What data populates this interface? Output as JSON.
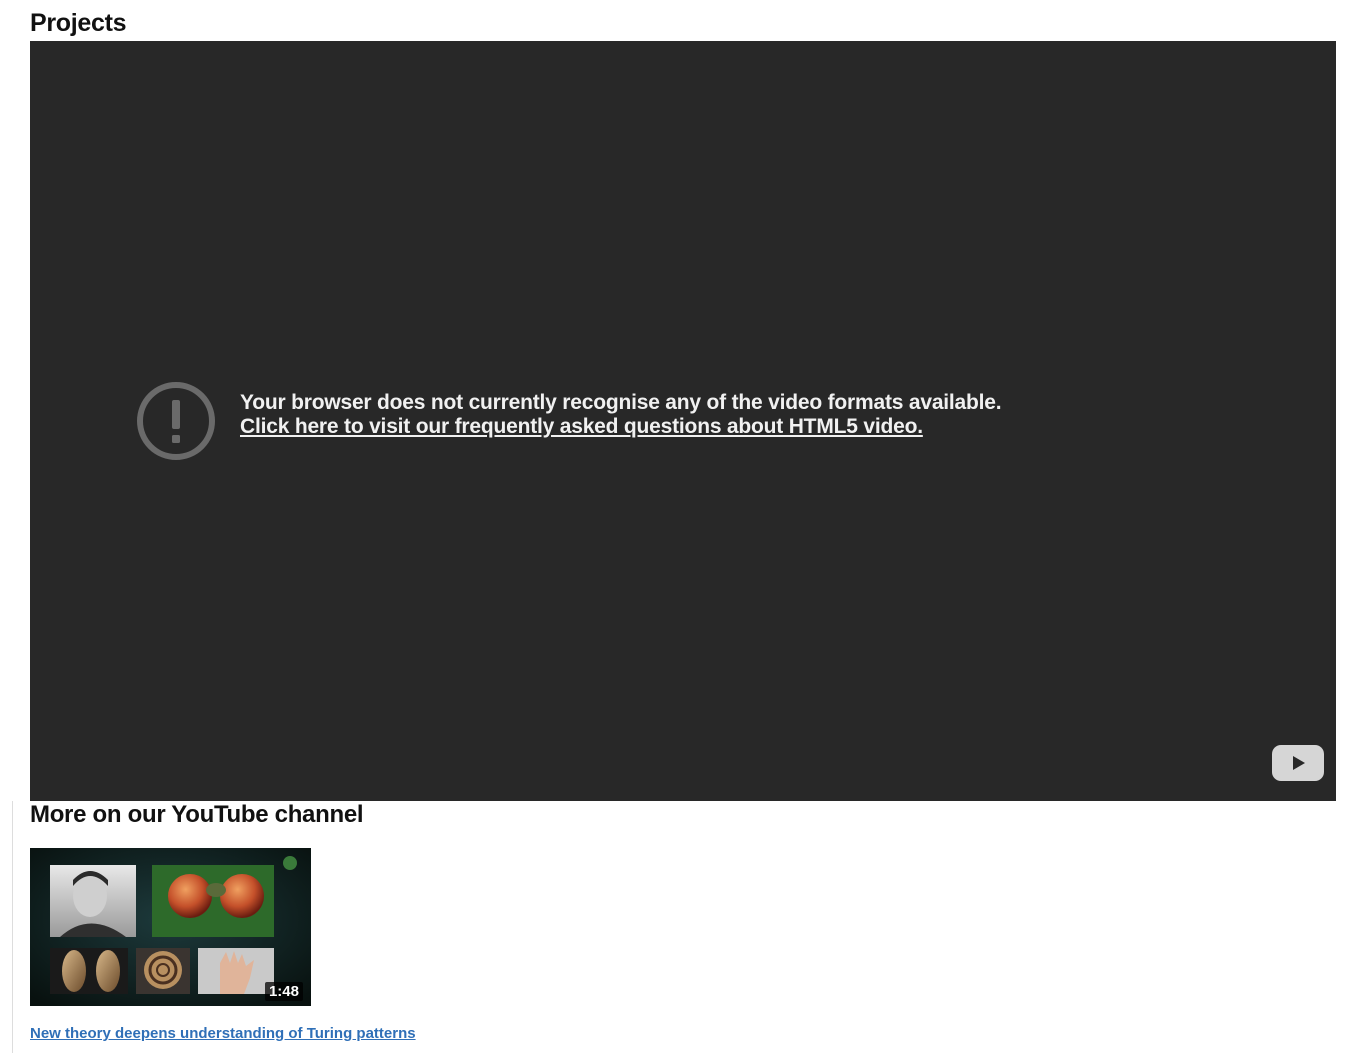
{
  "projects": {
    "title": "Projects"
  },
  "video_player": {
    "error_message": "Your browser does not currently recognise any of the video formats available.",
    "faq_link_label": "Click here to visit our frequently asked questions about HTML5 video.",
    "error_icon": "exclamation-circle-icon",
    "logo_icon": "youtube-play-icon"
  },
  "channel": {
    "title": "More on our YouTube channel",
    "videos": [
      {
        "duration": "1:48",
        "title": "New theory deepens understanding of Turing patterns"
      }
    ]
  },
  "colors": {
    "player_background": "#282828",
    "link": "#2f6fb7",
    "heading": "#111111"
  }
}
